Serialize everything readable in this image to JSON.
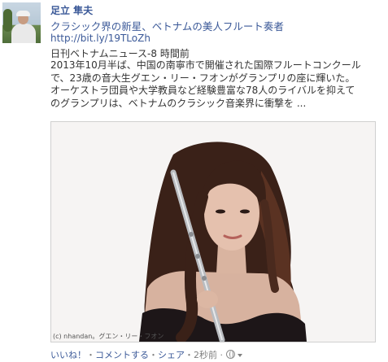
{
  "post": {
    "author": "足立 隼夫",
    "title": "クラシック界の新星、ベトナムの美人フルート奏者",
    "link": "http://bit.ly/19TLoZh",
    "source": "日刊ベトナムニュース‐8 時間前",
    "excerpt": [
      "2013年10月半ば、中国の南寧市で開催された国際フルートコンクール",
      "で、23歳の音大生グエン・リー・フオンがグランプリの座に輝いた。",
      "オーケストラ団員や大学教員など経験豊富な78人のライバルを抑えて",
      "のグランプリは、ベトナムのクラシック音楽界に衝撃を ..."
    ],
    "photo_caption": "(c) nhandan。グエン・リー・フオン"
  },
  "actions": {
    "like": "いいね！",
    "comment": "コメントする",
    "share": "シェア",
    "time": "2秒前",
    "sep": "・",
    "sep2": " · "
  },
  "icons": {
    "audience": "globe-icon",
    "menu": "chevron-down-icon"
  }
}
